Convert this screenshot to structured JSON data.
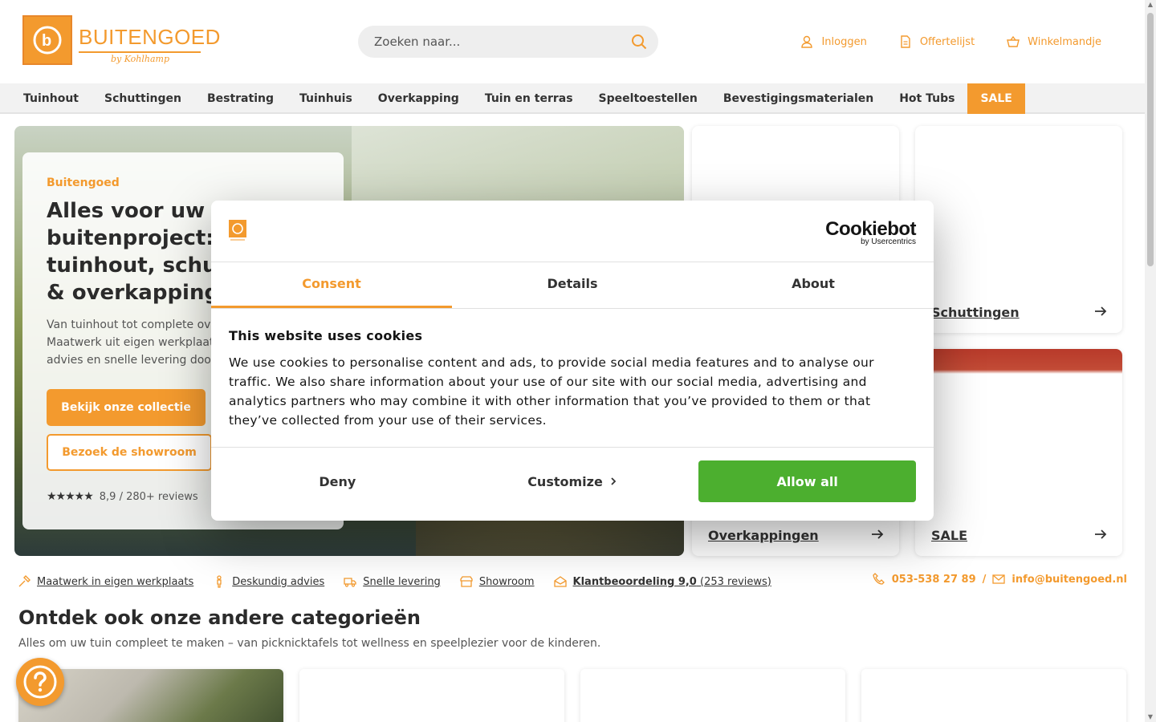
{
  "brand": {
    "name": "BUITENGOED",
    "sub": "by Kohlhamp",
    "accent": "#f39a2e"
  },
  "search": {
    "placeholder": "Zoeken naar..."
  },
  "header_links": [
    {
      "label": "Inloggen",
      "icon": "user-icon"
    },
    {
      "label": "Offertelijst",
      "icon": "document-icon"
    },
    {
      "label": "Winkelmandje",
      "icon": "basket-icon"
    }
  ],
  "nav": [
    "Tuinhout",
    "Schuttingen",
    "Bestrating",
    "Tuinhuis",
    "Overkapping",
    "Tuin en terras",
    "Speeltoestellen",
    "Bevestigingsmaterialen",
    "Hot Tubs",
    "SALE"
  ],
  "hero": {
    "kicker": "Buitengoed",
    "title": "Alles voor uw buitenproject: tuinhout, schuttingen & overkappingen",
    "description": "Van tuinhout tot complete overkappingen. Maatwerk uit eigen werkplaats, deskundig advies en snelle levering door heel Nederland.",
    "primary_button": "Bekijk onze collectie",
    "secondary_button": "Bezoek de showroom",
    "rating_text": "8,9 / 280+ reviews"
  },
  "tiles": [
    {
      "label": "Schuttingen"
    },
    {
      "label": "Overkappingen"
    },
    {
      "label": "SALE"
    }
  ],
  "usp": [
    {
      "label": "Maatwerk in eigen werkplaats",
      "icon": "hammer-icon"
    },
    {
      "label": "Deskundig advies",
      "icon": "person-icon"
    },
    {
      "label": "Snelle levering",
      "icon": "truck-icon"
    },
    {
      "label": "Showroom",
      "icon": "store-icon"
    },
    {
      "label_bold": "Klantbeoordeling 9,0",
      "label_rest": "(253 reviews)",
      "icon": "envelope-open-icon"
    }
  ],
  "contact": {
    "phone": "053-538 27 89",
    "separator": "/",
    "email": "info@buitengoed.nl"
  },
  "section": {
    "title": "Ontdek ook onze andere categorieën",
    "subtitle": "Alles om uw tuin compleet te maken – van picknicktafels tot wellness en speelplezier voor de kinderen."
  },
  "cookie": {
    "brand": "Cookiebot",
    "brand_sub": "by Usercentrics",
    "tabs": [
      "Consent",
      "Details",
      "About"
    ],
    "heading": "This website uses cookies",
    "body": "We use cookies to personalise content and ads, to provide social media features and to analyse our traffic. We also share information about your use of our site with our social media, advertising and analytics partners who may combine it with other information that you’ve provided to them or that they’ve collected from your use of their services.",
    "deny": "Deny",
    "customize": "Customize",
    "allow": "Allow all",
    "allow_color": "#4caf2f"
  }
}
